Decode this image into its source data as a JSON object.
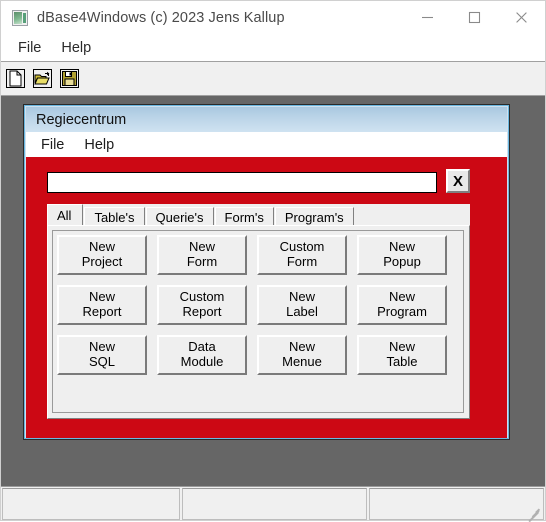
{
  "window": {
    "title": "dBase4Windows (c) 2023 Jens Kallup",
    "icon": "app-image-icon",
    "controls": {
      "minimize": "minimize-icon",
      "maximize": "maximize-icon",
      "close": "close-icon"
    }
  },
  "menubar": {
    "items": [
      {
        "label": "File"
      },
      {
        "label": "Help"
      }
    ]
  },
  "toolbar": {
    "buttons": [
      {
        "name": "new-file-icon",
        "tooltip": "New"
      },
      {
        "name": "open-folder-icon",
        "tooltip": "Open"
      },
      {
        "name": "save-disk-icon",
        "tooltip": "Save"
      }
    ]
  },
  "child_window": {
    "title": "Regiecentrum",
    "menubar": {
      "items": [
        {
          "label": "File"
        },
        {
          "label": "Help"
        }
      ]
    },
    "search": {
      "value": "",
      "placeholder": ""
    },
    "clear_button": {
      "label": "X"
    },
    "tabs": [
      {
        "label": "All",
        "selected": true
      },
      {
        "label": "Table's",
        "selected": false
      },
      {
        "label": "Querie's",
        "selected": false
      },
      {
        "label": "Form's",
        "selected": false
      },
      {
        "label": "Program's",
        "selected": false
      }
    ],
    "buttons": [
      {
        "label": "New\nProject"
      },
      {
        "label": "New\nForm"
      },
      {
        "label": "Custom\nForm"
      },
      {
        "label": "New\nPopup"
      },
      {
        "label": "New\nReport"
      },
      {
        "label": "Custom\nReport"
      },
      {
        "label": "New\nLabel"
      },
      {
        "label": "New\nProgram"
      },
      {
        "label": "New\nSQL"
      },
      {
        "label": "Data\nModule"
      },
      {
        "label": "New\nMenue"
      },
      {
        "label": "New\nTable"
      }
    ]
  },
  "statusbar": {
    "panels": [
      {
        "text": ""
      },
      {
        "text": ""
      },
      {
        "text": ""
      }
    ]
  },
  "colors": {
    "accent_red": "#cc0814",
    "desktop_gray": "#666666",
    "child_title": "#bcd5e8",
    "control_face": "#efefef"
  }
}
